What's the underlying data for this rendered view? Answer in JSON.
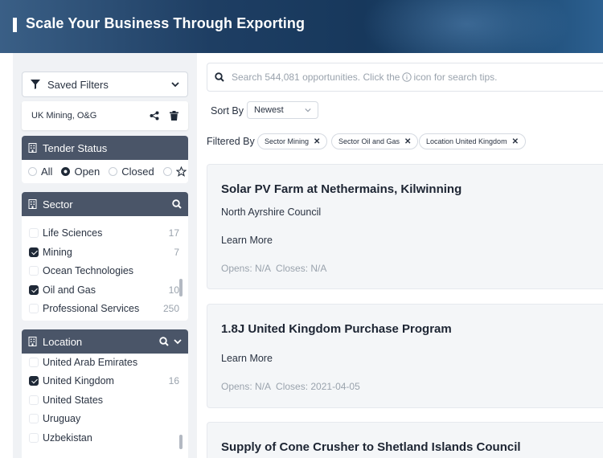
{
  "banner": {
    "title": "Scale Your Business Through Exporting"
  },
  "sidebar": {
    "saved_filters_label": "Saved Filters",
    "saved_filter_name": "UK Mining, O&G",
    "tender_status": {
      "title": "Tender Status",
      "options": [
        "All",
        "Open",
        "Closed"
      ],
      "selected": "Open"
    },
    "sector": {
      "title": "Sector",
      "items": [
        {
          "label": "Life Sciences",
          "count": "17",
          "checked": false
        },
        {
          "label": "Mining",
          "count": "7",
          "checked": true
        },
        {
          "label": "Ocean Technologies",
          "count": "",
          "checked": false
        },
        {
          "label": "Oil and Gas",
          "count": "10",
          "checked": true
        },
        {
          "label": "Professional Services",
          "count": "250",
          "checked": false
        }
      ]
    },
    "location": {
      "title": "Location",
      "items": [
        {
          "label": "United Arab Emirates",
          "count": "",
          "checked": false
        },
        {
          "label": "United Kingdom",
          "count": "16",
          "checked": true
        },
        {
          "label": "United States",
          "count": "",
          "checked": false
        },
        {
          "label": "Uruguay",
          "count": "",
          "checked": false
        },
        {
          "label": "Uzbekistan",
          "count": "",
          "checked": false
        }
      ]
    }
  },
  "search": {
    "placeholder_before": "Search 544,081 opportunities. Click the",
    "placeholder_after": "icon for search tips."
  },
  "sort": {
    "label": "Sort By",
    "value": "Newest"
  },
  "filters": {
    "label": "Filtered By",
    "chips": [
      "Sector Mining",
      "Sector Oil and Gas",
      "Location United Kingdom"
    ]
  },
  "results": [
    {
      "title": "Solar PV Farm at Nethermains, Kilwinning",
      "org": "North Ayrshire Council",
      "learn": "Learn More",
      "opens": "Opens: N/A",
      "closes": "Closes: N/A"
    },
    {
      "title": "1.8J United Kingdom Purchase Program",
      "org": "",
      "learn": "Learn More",
      "opens": "Opens: N/A",
      "closes": "Closes: 2021-04-05"
    },
    {
      "title": "Supply of Cone Crusher to Shetland Islands Council",
      "org": "",
      "learn": "",
      "opens": "",
      "closes": ""
    }
  ],
  "colors": {
    "banner": "#1e3e63",
    "section_header": "#4a5568",
    "checkbox_on": "#1f2937"
  }
}
